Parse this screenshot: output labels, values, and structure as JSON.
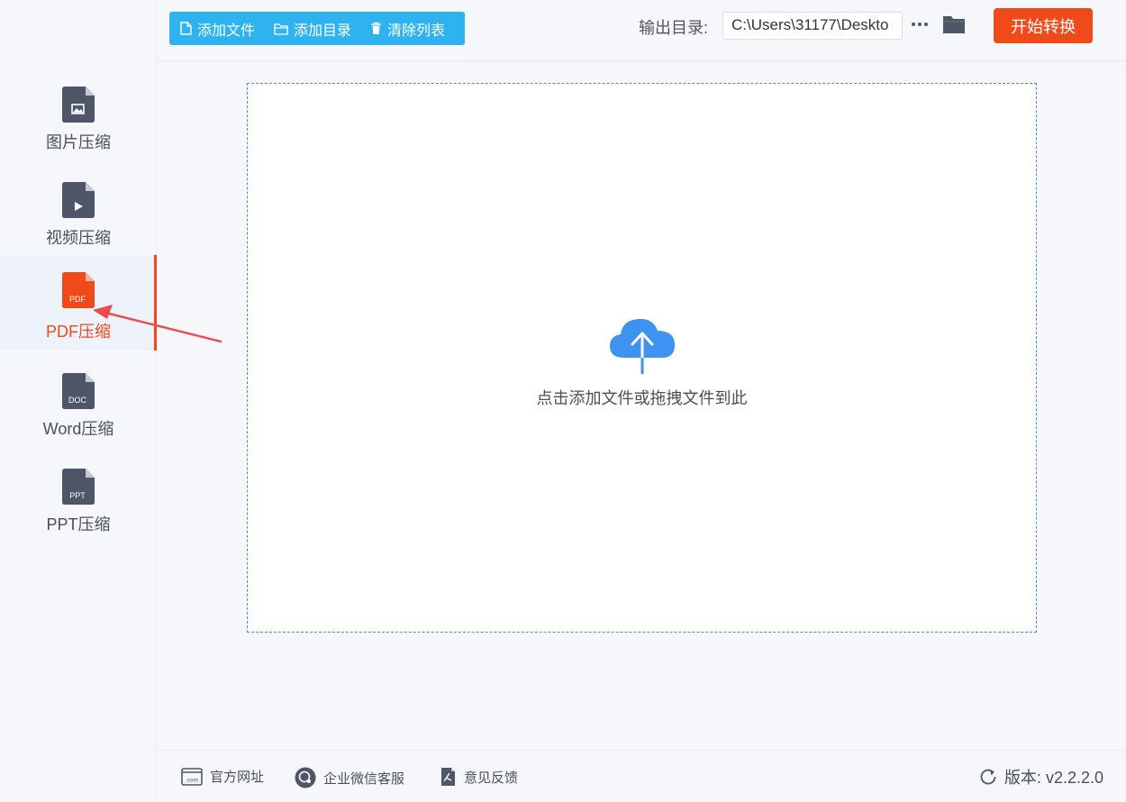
{
  "toolbar": {
    "add_file": "添加文件",
    "add_dir": "添加目录",
    "clear_list": "清除列表",
    "output_label": "输出目录:",
    "output_path": "C:\\Users\\31177\\Deskto",
    "start": "开始转换"
  },
  "sidebar": {
    "items": [
      {
        "label": "图片压缩",
        "badge": ""
      },
      {
        "label": "视频压缩",
        "badge": ""
      },
      {
        "label": "PDF压缩",
        "badge": "PDF"
      },
      {
        "label": "Word压缩",
        "badge": "DOC"
      },
      {
        "label": "PPT压缩",
        "badge": "PPT"
      }
    ],
    "active_index": 2
  },
  "dropzone": {
    "text": "点击添加文件或拖拽文件到此"
  },
  "footer": {
    "website": "官方网址",
    "wechat": "企业微信客服",
    "feedback": "意见反馈",
    "version": "版本:  v2.2.2.0"
  },
  "colors": {
    "accent": "#f04a1a",
    "toolbar_blue": "#2eb3f0",
    "icon_gray": "#4f5667",
    "cloud_blue": "#3d93ef"
  }
}
